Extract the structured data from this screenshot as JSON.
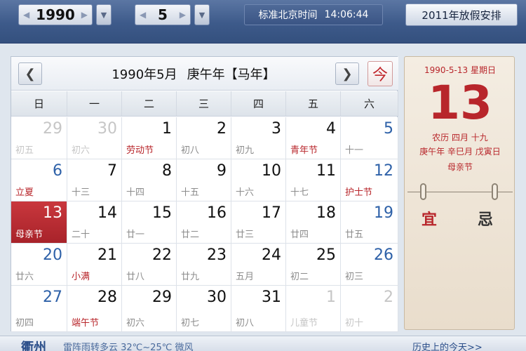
{
  "toolbar": {
    "year": "1990",
    "month": "5",
    "time_label": "标准北京时间",
    "time": "14:06:44",
    "holiday_button": "2011年放假安排"
  },
  "calendar": {
    "title": "1990年5月",
    "ganzhi": "庚午年【马年】",
    "today_button": "今",
    "weekdays": [
      "日",
      "一",
      "二",
      "三",
      "四",
      "五",
      "六"
    ],
    "weeks": [
      [
        {
          "d": "29",
          "l": "初五",
          "other": true
        },
        {
          "d": "30",
          "l": "初六",
          "other": true
        },
        {
          "d": "1",
          "l": "劳动节",
          "fest": true
        },
        {
          "d": "2",
          "l": "初八"
        },
        {
          "d": "3",
          "l": "初九"
        },
        {
          "d": "4",
          "l": "青年节",
          "fest": true
        },
        {
          "d": "5",
          "l": "十一"
        }
      ],
      [
        {
          "d": "6",
          "l": "立夏",
          "fest": true
        },
        {
          "d": "7",
          "l": "十三"
        },
        {
          "d": "8",
          "l": "十四"
        },
        {
          "d": "9",
          "l": "十五"
        },
        {
          "d": "10",
          "l": "十六"
        },
        {
          "d": "11",
          "l": "十七"
        },
        {
          "d": "12",
          "l": "护士节",
          "fest": true
        }
      ],
      [
        {
          "d": "13",
          "l": "母亲节",
          "fest": true,
          "selected": true
        },
        {
          "d": "14",
          "l": "二十"
        },
        {
          "d": "15",
          "l": "廿一"
        },
        {
          "d": "16",
          "l": "廿二"
        },
        {
          "d": "17",
          "l": "廿三"
        },
        {
          "d": "18",
          "l": "廿四"
        },
        {
          "d": "19",
          "l": "廿五"
        }
      ],
      [
        {
          "d": "20",
          "l": "廿六"
        },
        {
          "d": "21",
          "l": "小满",
          "fest": true
        },
        {
          "d": "22",
          "l": "廿八"
        },
        {
          "d": "23",
          "l": "廿九"
        },
        {
          "d": "24",
          "l": "五月"
        },
        {
          "d": "25",
          "l": "初二"
        },
        {
          "d": "26",
          "l": "初三"
        }
      ],
      [
        {
          "d": "27",
          "l": "初四"
        },
        {
          "d": "28",
          "l": "端午节",
          "fest": true
        },
        {
          "d": "29",
          "l": "初六"
        },
        {
          "d": "30",
          "l": "初七"
        },
        {
          "d": "31",
          "l": "初八"
        },
        {
          "d": "1",
          "l": "儿童节",
          "other": true
        },
        {
          "d": "2",
          "l": "初十",
          "other": true
        }
      ]
    ]
  },
  "almanac": {
    "date_line": "1990-5-13 星期日",
    "big_day": "13",
    "lunar_line": "农历 四月 十九",
    "ganzhi_line": "庚午年 辛巳月 戊寅日",
    "festival": "母亲节",
    "yi": "宜",
    "ji": "忌"
  },
  "footer": {
    "city": "衢州",
    "weather": "雷阵雨转多云  32℃~25℃ 微风",
    "history": "历史上的今天>>"
  },
  "colors": {
    "accent_red": "#b8262b",
    "weekend_blue": "#2e61a8",
    "toolbar_blue": "#3d5a8a"
  }
}
